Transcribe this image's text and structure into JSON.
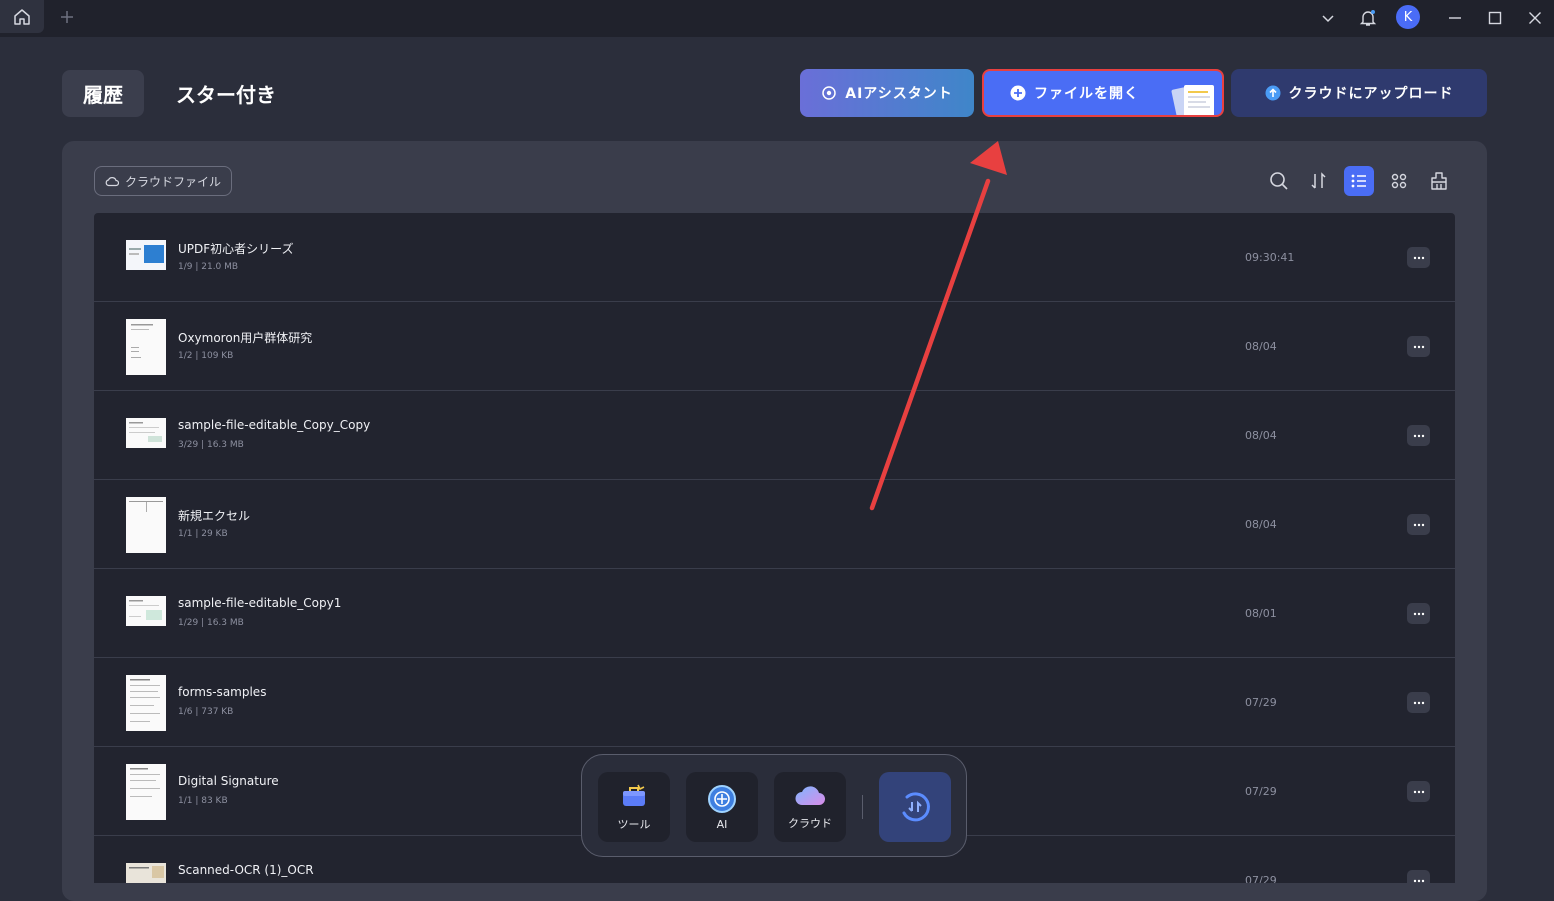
{
  "titlebar": {
    "avatar_initial": "K"
  },
  "tabs": {
    "history": "履歴",
    "starred": "スター付き"
  },
  "actions": {
    "ai_assistant": "AIアシスタント",
    "open_file": "ファイルを開く",
    "upload_cloud": "クラウドにアップロード"
  },
  "filter": {
    "cloud_files": "クラウドファイル"
  },
  "files": [
    {
      "name": "UPDF初心者シリーズ",
      "meta": "1/9 | 21.0 MB",
      "date": "09:30:41"
    },
    {
      "name": "Oxymoron用户群体研究",
      "meta": "1/2 | 109 KB",
      "date": "08/04"
    },
    {
      "name": "sample-file-editable_Copy_Copy",
      "meta": "3/29 | 16.3 MB",
      "date": "08/04"
    },
    {
      "name": "新規エクセル",
      "meta": "1/1 | 29 KB",
      "date": "08/04"
    },
    {
      "name": "sample-file-editable_Copy1",
      "meta": "1/29 | 16.3 MB",
      "date": "08/01"
    },
    {
      "name": "forms-samples",
      "meta": "1/6 | 737 KB",
      "date": "07/29"
    },
    {
      "name": "Digital Signature",
      "meta": "1/1 | 83 KB",
      "date": "07/29"
    },
    {
      "name": "Scanned-OCR (1)_OCR",
      "meta": "",
      "date": "07/29"
    }
  ],
  "dock": {
    "tools": "ツール",
    "ai": "AI",
    "cloud": "クラウド"
  },
  "colors": {
    "accent": "#4a6df5",
    "highlight": "#e84040",
    "background": "#2b2e3b"
  }
}
